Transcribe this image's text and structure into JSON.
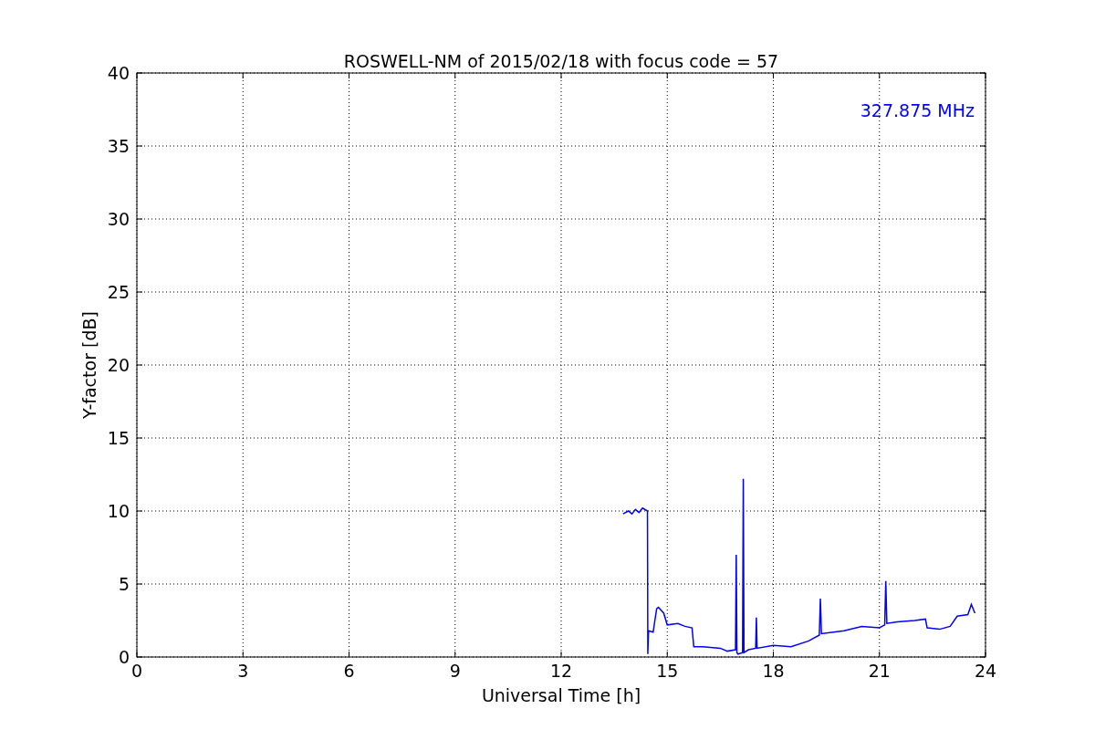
{
  "chart_data": {
    "type": "line",
    "title": "ROSWELL-NM of 2015/02/18 with focus code = 57",
    "xlabel": "Universal Time [h]",
    "ylabel": "Y-factor [dB]",
    "x": [
      13.75,
      13.9,
      14.0,
      14.1,
      14.2,
      14.3,
      14.44,
      14.45,
      14.47,
      14.6,
      14.7,
      14.75,
      14.9,
      15.0,
      15.3,
      15.5,
      15.7,
      15.75,
      16.0,
      16.5,
      16.7,
      16.93,
      16.95,
      16.97,
      17.0,
      17.13,
      17.15,
      17.17,
      17.3,
      17.5,
      17.52,
      17.54,
      18.0,
      18.5,
      19.0,
      19.3,
      19.33,
      19.36,
      19.7,
      20.0,
      20.5,
      21.0,
      21.15,
      21.18,
      21.21,
      21.5,
      22.0,
      22.3,
      22.35,
      22.7,
      23.0,
      23.2,
      23.5,
      23.6,
      23.7
    ],
    "series": [
      {
        "name": "327.875 MHz",
        "color": "#0000ff",
        "values": [
          9.8,
          10.0,
          9.8,
          10.1,
          9.9,
          10.2,
          10.0,
          0.2,
          1.8,
          1.7,
          3.3,
          3.4,
          3.0,
          2.2,
          2.3,
          2.1,
          2.0,
          0.7,
          0.7,
          0.6,
          0.4,
          0.5,
          7.0,
          0.3,
          0.2,
          0.3,
          12.2,
          0.3,
          0.5,
          0.6,
          2.7,
          0.6,
          0.8,
          0.7,
          1.1,
          1.5,
          4.0,
          1.6,
          1.7,
          1.8,
          2.1,
          2.0,
          2.2,
          5.2,
          2.3,
          2.4,
          2.5,
          2.6,
          2.0,
          1.9,
          2.1,
          2.8,
          2.9,
          3.6,
          3.0
        ]
      }
    ],
    "xlim": [
      0,
      24
    ],
    "ylim": [
      0,
      40
    ],
    "xticks": [
      0,
      3,
      6,
      9,
      12,
      15,
      18,
      21,
      24
    ],
    "yticks": [
      0,
      5,
      10,
      15,
      20,
      25,
      30,
      35,
      40
    ],
    "grid": true
  }
}
